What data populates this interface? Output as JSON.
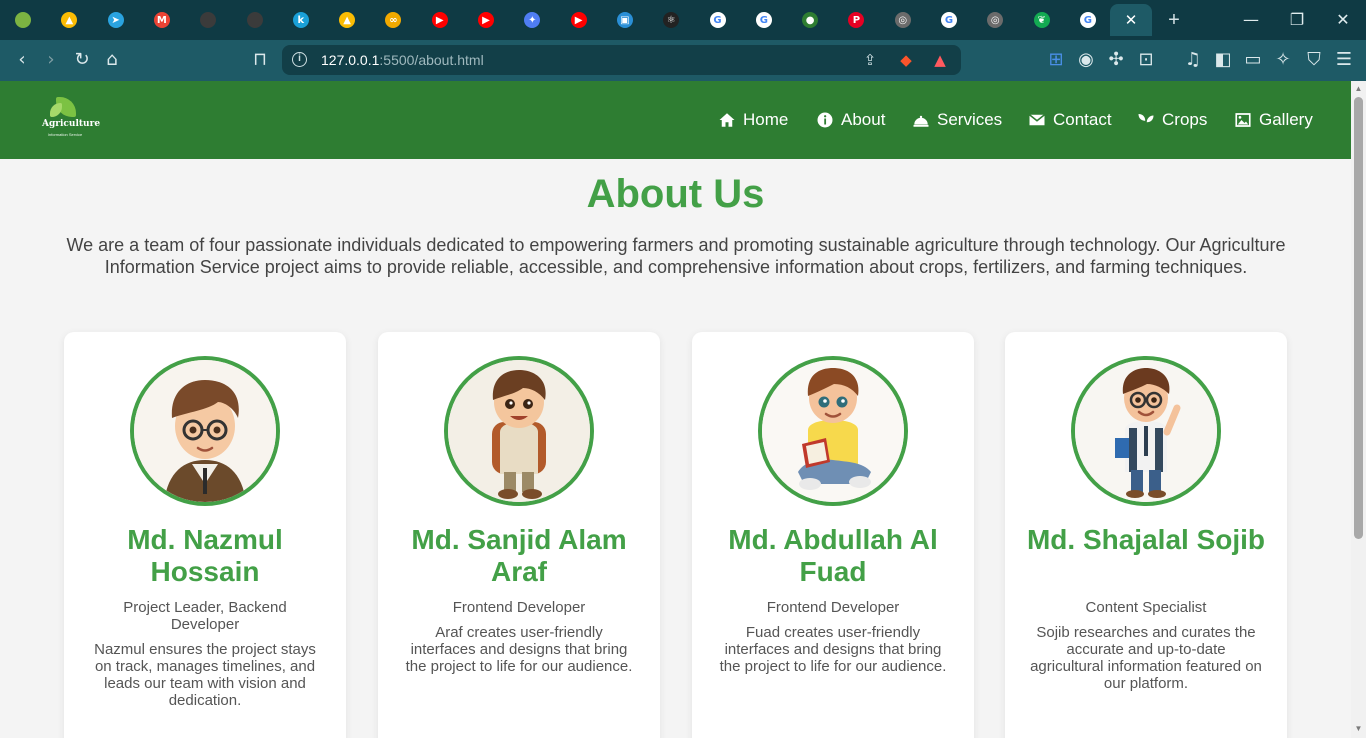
{
  "browser": {
    "url_host": "127.0.0.1",
    "url_path": ":5500/about.html",
    "active_tab_close": "✕",
    "new_tab": "+",
    "tabs": [
      {
        "icon": "agri-logo-icon",
        "color": "#7cb342",
        "glyph": ""
      },
      {
        "icon": "google-drive-icon",
        "color": "#fbbc04",
        "glyph": "▲"
      },
      {
        "icon": "telegram-icon",
        "color": "#2aa3e0",
        "glyph": "➤"
      },
      {
        "icon": "gmail-icon",
        "color": "#ea4335",
        "glyph": "M"
      },
      {
        "icon": "github-icon",
        "color": "#3b3b3b",
        "glyph": ""
      },
      {
        "icon": "github-icon",
        "color": "#3b3b3b",
        "glyph": ""
      },
      {
        "icon": "k-icon",
        "color": "#1aa0d8",
        "glyph": "k"
      },
      {
        "icon": "google-drive-icon",
        "color": "#fbbc04",
        "glyph": "▲"
      },
      {
        "icon": "infinity-icon",
        "color": "#f2a900",
        "glyph": "∞"
      },
      {
        "icon": "youtube-icon",
        "color": "#ff0000",
        "glyph": "▶"
      },
      {
        "icon": "youtube-icon",
        "color": "#ff0000",
        "glyph": "▶"
      },
      {
        "icon": "gemini-icon",
        "color": "#4f7df3",
        "glyph": "✦"
      },
      {
        "icon": "youtube-icon",
        "color": "#ff0000",
        "glyph": "▶"
      },
      {
        "icon": "wallet-icon",
        "color": "#2a8fd6",
        "glyph": "▣"
      },
      {
        "icon": "react-icon",
        "color": "#222222",
        "glyph": "⚛"
      },
      {
        "icon": "google-icon",
        "color": "#ffffff",
        "glyph": "G"
      },
      {
        "icon": "google-icon",
        "color": "#ffffff",
        "glyph": "G"
      },
      {
        "icon": "chatbot-icon",
        "color": "#2e7d32",
        "glyph": "●"
      },
      {
        "icon": "pinterest-icon",
        "color": "#e60023",
        "glyph": "P"
      },
      {
        "icon": "openai-icon",
        "color": "#6b6b6b",
        "glyph": "◎"
      },
      {
        "icon": "google-icon",
        "color": "#ffffff",
        "glyph": "G"
      },
      {
        "icon": "openai-icon",
        "color": "#6b6b6b",
        "glyph": "◎"
      },
      {
        "icon": "mongodb-leaf-icon",
        "color": "#13aa52",
        "glyph": "❦"
      },
      {
        "icon": "google-icon",
        "color": "#ffffff",
        "glyph": "G"
      }
    ],
    "window_controls": [
      "—",
      "❐",
      "✕"
    ]
  },
  "site": {
    "logo_text": "Agriculture",
    "logo_subtext": "Information Service",
    "nav": [
      {
        "label": "Home",
        "icon": "home-icon"
      },
      {
        "label": "About",
        "icon": "info-icon"
      },
      {
        "label": "Services",
        "icon": "bell-icon"
      },
      {
        "label": "Contact",
        "icon": "envelope-icon"
      },
      {
        "label": "Crops",
        "icon": "seedling-icon"
      },
      {
        "label": "Gallery",
        "icon": "image-icon"
      }
    ]
  },
  "about": {
    "title": "About Us",
    "intro": "We are a team of four passionate individuals dedicated to empowering farmers and promoting sustainable agriculture through technology. Our Agriculture Information Service project aims to provide reliable, accessible, and comprehensive information about crops, fertilizers, and farming techniques."
  },
  "team": [
    {
      "name": "Md. Nazmul Hossain",
      "role": "Project Leader, Backend Developer",
      "desc": "Nazmul ensures the project stays on track, manages timelines, and leads our team with vision and dedication."
    },
    {
      "name": "Md. Sanjid Alam Araf",
      "role": "Frontend Developer",
      "desc": "Araf creates user-friendly interfaces and designs that bring the project to life for our audience."
    },
    {
      "name": "Md. Abdullah Al Fuad",
      "role": "Frontend Developer",
      "desc": "Fuad creates user-friendly interfaces and designs that bring the project to life for our audience."
    },
    {
      "name": "Md. Shajalal Sojib",
      "role": "Content Specialist",
      "desc": "Sojib researches and curates the accurate and up-to-date agricultural information featured on our platform."
    }
  ]
}
